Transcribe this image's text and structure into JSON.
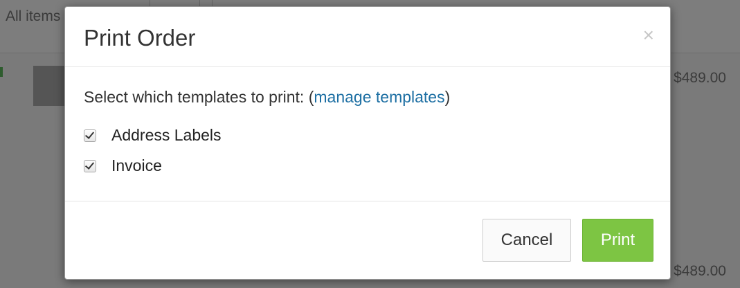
{
  "background": {
    "tab_label": "All items",
    "prices": [
      "$489.00",
      "$489.00"
    ]
  },
  "modal": {
    "title": "Print Order",
    "close_symbol": "×",
    "instruction_prefix": "Select which templates to print: (",
    "manage_link": "manage templates",
    "instruction_suffix": ")",
    "templates": [
      {
        "label": "Address Labels",
        "checked": true
      },
      {
        "label": "Invoice",
        "checked": true
      }
    ],
    "cancel_label": "Cancel",
    "print_label": "Print",
    "colors": {
      "print_button": "#7dc543",
      "link": "#1d6fa3"
    }
  }
}
